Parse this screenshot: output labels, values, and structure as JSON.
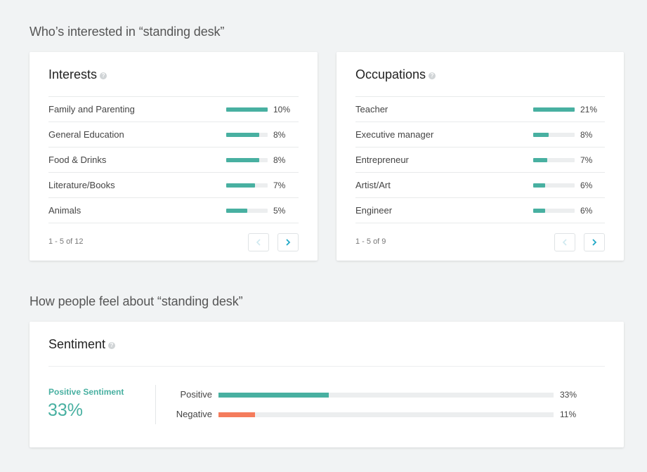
{
  "sections": {
    "interest_heading": "Who’s interested in “standing desk”",
    "feel_heading": "How people feel about “standing desk”"
  },
  "interests": {
    "title": "Interests",
    "items": [
      {
        "label": "Family and Parenting",
        "value": 10,
        "pct": "10%"
      },
      {
        "label": "General Education",
        "value": 8,
        "pct": "8%"
      },
      {
        "label": "Food & Drinks",
        "value": 8,
        "pct": "8%"
      },
      {
        "label": "Literature/Books",
        "value": 7,
        "pct": "7%"
      },
      {
        "label": "Animals",
        "value": 5,
        "pct": "5%"
      }
    ],
    "pager": "1 - 5 of 12",
    "bar_max": 10
  },
  "occupations": {
    "title": "Occupations",
    "items": [
      {
        "label": "Teacher",
        "value": 21,
        "pct": "21%"
      },
      {
        "label": "Executive manager",
        "value": 8,
        "pct": "8%"
      },
      {
        "label": "Entrepreneur",
        "value": 7,
        "pct": "7%"
      },
      {
        "label": "Artist/Art",
        "value": 6,
        "pct": "6%"
      },
      {
        "label": "Engineer",
        "value": 6,
        "pct": "6%"
      }
    ],
    "pager": "1 - 5 of 9",
    "bar_max": 21
  },
  "sentiment": {
    "title": "Sentiment",
    "positive_label": "Positive Sentiment",
    "positive_value": "33%",
    "bars": [
      {
        "label": "Positive",
        "value": 33,
        "pct": "33%",
        "color": "#48b0a1"
      },
      {
        "label": "Negative",
        "value": 11,
        "pct": "11%",
        "color": "#f47c5c"
      }
    ],
    "bar_max": 100
  },
  "icons": {
    "help": "help-circle-icon",
    "prev": "chevron-left-icon",
    "next": "chevron-right-icon"
  },
  "colors": {
    "accent": "#48b0a1",
    "negative": "#f47c5c",
    "pager_active": "#20a8c7"
  }
}
